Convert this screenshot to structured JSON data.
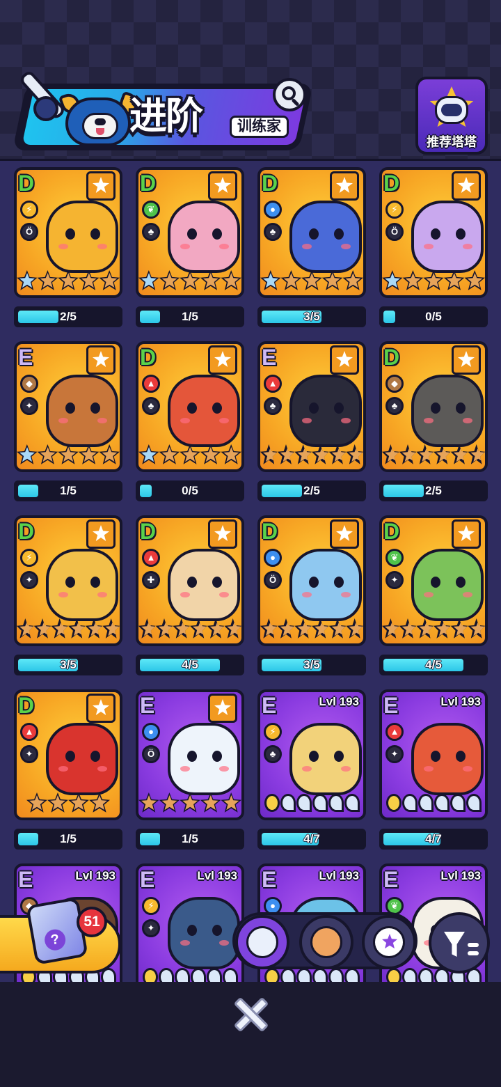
{
  "header": {
    "title": "进阶",
    "subtitle": "训练家",
    "recommend_label": "推荐塔塔"
  },
  "gift": {
    "badge_count": "51"
  },
  "colors": {
    "gold_card": "#f7a624",
    "purple_card": "#8a3be0",
    "progress": "#2cc6e8",
    "background": "#2f2c60"
  },
  "cards": [
    {
      "grade": "D",
      "frame": "gold",
      "favorite": true,
      "level": "",
      "element": "lightning",
      "role": "bag",
      "star_count": 5,
      "blue_stars": 1,
      "progress": "2/5",
      "progress_value": 0.4,
      "creature_color": "#f5b431"
    },
    {
      "grade": "D",
      "frame": "gold",
      "favorite": true,
      "level": "",
      "element": "leaf",
      "role": "support",
      "star_count": 5,
      "blue_stars": 1,
      "progress": "1/5",
      "progress_value": 0.2,
      "creature_color": "#f2a8c2"
    },
    {
      "grade": "D",
      "frame": "gold",
      "favorite": true,
      "level": "",
      "element": "water",
      "role": "support",
      "star_count": 5,
      "blue_stars": 1,
      "progress": "3/5",
      "progress_value": 0.6,
      "creature_color": "#4a6ad8"
    },
    {
      "grade": "D",
      "frame": "gold",
      "favorite": true,
      "level": "",
      "element": "lightning",
      "role": "bag",
      "star_count": 5,
      "blue_stars": 1,
      "progress": "0/5",
      "progress_value": 0,
      "creature_color": "#c9a8ee"
    },
    {
      "grade": "E",
      "frame": "gold",
      "favorite": true,
      "level": "",
      "element": "earth",
      "role": "attack",
      "star_count": 5,
      "blue_stars": 1,
      "progress": "1/5",
      "progress_value": 0.2,
      "creature_color": "#c8763a"
    },
    {
      "grade": "D",
      "frame": "gold",
      "favorite": true,
      "level": "",
      "element": "fire",
      "role": "support",
      "star_count": 5,
      "blue_stars": 1,
      "progress": "0/5",
      "progress_value": 0,
      "creature_color": "#e4563a"
    },
    {
      "grade": "E",
      "frame": "gold",
      "favorite": true,
      "level": "",
      "element": "fire",
      "role": "support",
      "star_count": 6,
      "blue_stars": 0,
      "progress": "2/5",
      "progress_value": 0.4,
      "creature_color": "#2a2a3a"
    },
    {
      "grade": "D",
      "frame": "gold",
      "favorite": true,
      "level": "",
      "element": "earth",
      "role": "support",
      "star_count": 6,
      "blue_stars": 0,
      "progress": "2/5",
      "progress_value": 0.4,
      "creature_color": "#5c5a58"
    },
    {
      "grade": "D",
      "frame": "gold",
      "favorite": true,
      "level": "",
      "element": "lightning",
      "role": "attack",
      "star_count": 6,
      "blue_stars": 0,
      "progress": "3/5",
      "progress_value": 0.6,
      "creature_color": "#f2c04a"
    },
    {
      "grade": "D",
      "frame": "gold",
      "favorite": true,
      "level": "",
      "element": "fire",
      "role": "heal",
      "star_count": 6,
      "blue_stars": 0,
      "progress": "4/5",
      "progress_value": 0.8,
      "creature_color": "#f1d4a8"
    },
    {
      "grade": "D",
      "frame": "gold",
      "favorite": true,
      "level": "",
      "element": "water",
      "role": "bag",
      "star_count": 6,
      "blue_stars": 0,
      "progress": "3/5",
      "progress_value": 0.6,
      "creature_color": "#8fc8f0"
    },
    {
      "grade": "D",
      "frame": "gold",
      "favorite": true,
      "level": "",
      "element": "leaf",
      "role": "attack",
      "star_count": 6,
      "blue_stars": 0,
      "progress": "4/5",
      "progress_value": 0.8,
      "creature_color": "#7cc25a"
    },
    {
      "grade": "D",
      "frame": "gold",
      "favorite": true,
      "level": "",
      "element": "fire",
      "role": "attack",
      "star_count": 4,
      "blue_stars": 0,
      "progress": "1/5",
      "progress_value": 0.2,
      "creature_color": "#d9342e"
    },
    {
      "grade": "E",
      "frame": "purple",
      "favorite": true,
      "level": "",
      "element": "water",
      "role": "bag",
      "star_count": 5,
      "blue_stars": 0,
      "progress": "1/5",
      "progress_value": 0.2,
      "creature_color": "#eef4fb"
    },
    {
      "grade": "E",
      "frame": "purple",
      "favorite": false,
      "level": "Lvl 193",
      "element": "lightning",
      "role": "support",
      "star_count": 0,
      "waves": true,
      "progress": "4/7",
      "progress_value": 0.57,
      "creature_color": "#f2d27a"
    },
    {
      "grade": "E",
      "frame": "purple",
      "favorite": false,
      "level": "Lvl 193",
      "element": "fire",
      "role": "attack",
      "star_count": 0,
      "waves": true,
      "progress": "4/7",
      "progress_value": 0.57,
      "creature_color": "#e65a3a"
    },
    {
      "grade": "E",
      "frame": "purple",
      "favorite": false,
      "level": "Lvl 193",
      "element": "earth",
      "role": "",
      "star_count": 0,
      "waves": true,
      "progress": "",
      "progress_value": null,
      "creature_color": "#6b4430"
    },
    {
      "grade": "E",
      "frame": "purple",
      "favorite": false,
      "level": "Lvl 193",
      "element": "lightning",
      "role": "attack",
      "star_count": 0,
      "waves": true,
      "progress": "",
      "progress_value": null,
      "creature_color": "#3a5a8a"
    },
    {
      "grade": "E",
      "frame": "purple",
      "favorite": false,
      "level": "Lvl 193",
      "element": "water",
      "role": "",
      "star_count": 0,
      "waves": true,
      "progress": "",
      "progress_value": null,
      "creature_color": "#6cc2e8"
    },
    {
      "grade": "E",
      "frame": "purple",
      "favorite": false,
      "level": "Lvl 193",
      "element": "leaf",
      "role": "",
      "star_count": 0,
      "waves": true,
      "progress": "",
      "progress_value": null,
      "creature_color": "#f4f0e6"
    }
  ],
  "filters": [
    {
      "name": "filter-all-icon",
      "active": true
    },
    {
      "name": "filter-creature-icon",
      "active": false
    },
    {
      "name": "filter-star-icon",
      "active": false
    }
  ],
  "icons": {
    "search": "search-icon",
    "close": "close-icon",
    "sort": "sort-filter-icon",
    "gift": "mystery-box-icon"
  }
}
